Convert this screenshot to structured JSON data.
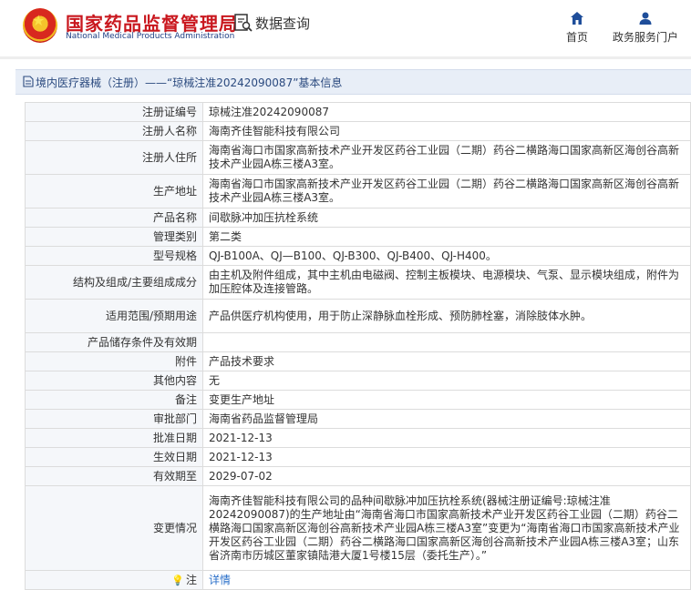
{
  "header": {
    "site_title": "国家药品监督管理局",
    "site_subtitle": "National Medical Products Administration",
    "query_label": "数据查询",
    "nav": [
      {
        "label": "首页",
        "icon": "home-icon"
      },
      {
        "label": "政务服务门户",
        "icon": "user-icon"
      }
    ]
  },
  "breadcrumb": {
    "text": "境内医疗器械（注册）——“琼械注准20242090087”基本信息",
    "icon": "document-icon"
  },
  "details": {
    "rows": [
      {
        "label": "注册证编号",
        "value": "琼械注准20242090087"
      },
      {
        "label": "注册人名称",
        "value": "海南齐佳智能科技有限公司"
      },
      {
        "label": "注册人住所",
        "value": "海南省海口市国家高新技术产业开发区药谷工业园（二期）药谷二横路海口国家高新区海创谷高新技术产业园A栋三楼A3室。"
      },
      {
        "label": "生产地址",
        "value": "海南省海口市国家高新技术产业开发区药谷工业园（二期）药谷二横路海口国家高新区海创谷高新技术产业园A栋三楼A3室。"
      },
      {
        "label": "产品名称",
        "value": "间歇脉冲加压抗栓系统"
      },
      {
        "label": "管理类别",
        "value": "第二类"
      },
      {
        "label": "型号规格",
        "value": "QJ-B100A、QJ—B100、QJ-B300、QJ-B400、QJ-H400。"
      },
      {
        "label": "结构及组成/主要组成成分",
        "value": "由主机及附件组成，其中主机由电磁阀、控制主板模块、电源模块、气泵、显示模块组成，附件为加压腔体及连接管路。"
      },
      {
        "label": "适用范围/预期用途",
        "value": "产品供医疗机构使用，用于防止深静脉血栓形成、预防肺栓塞，消除肢体水肿。"
      },
      {
        "label": "产品储存条件及有效期",
        "value": ""
      },
      {
        "label": "附件",
        "value": "产品技术要求"
      },
      {
        "label": "其他内容",
        "value": "无"
      },
      {
        "label": "备注",
        "value": "变更生产地址"
      },
      {
        "label": "审批部门",
        "value": "海南省药品监督管理局"
      },
      {
        "label": "批准日期",
        "value": "2021-12-13"
      },
      {
        "label": "生效日期",
        "value": "2021-12-13"
      },
      {
        "label": "有效期至",
        "value": "2029-07-02"
      },
      {
        "label": "变更情况",
        "value": "海南齐佳智能科技有限公司的品种间歇脉冲加压抗栓系统(器械注册证编号:琼械注准20242090087)的生产地址由“海南省海口市国家高新技术产业开发区药谷工业园（二期）药谷二横路海口国家高新区海创谷高新技术产业园A栋三楼A3室”变更为“海南省海口市国家高新技术产业开发区药谷工业园（二期）药谷二横路海口国家高新区海创谷高新技术产业园A栋三楼A3室；山东省济南市历城区董家镇陆港大厦1号楼15层（委托生产）。”"
      }
    ],
    "last_row": {
      "label_icon": "lightbulb-icon",
      "label": "注",
      "link": "详情"
    }
  },
  "colors": {
    "title_red": "#c9171e",
    "subtitle_blue": "#1f3f85",
    "crumb_bg": "#e8eef7",
    "link_blue": "#2a6fc9"
  }
}
